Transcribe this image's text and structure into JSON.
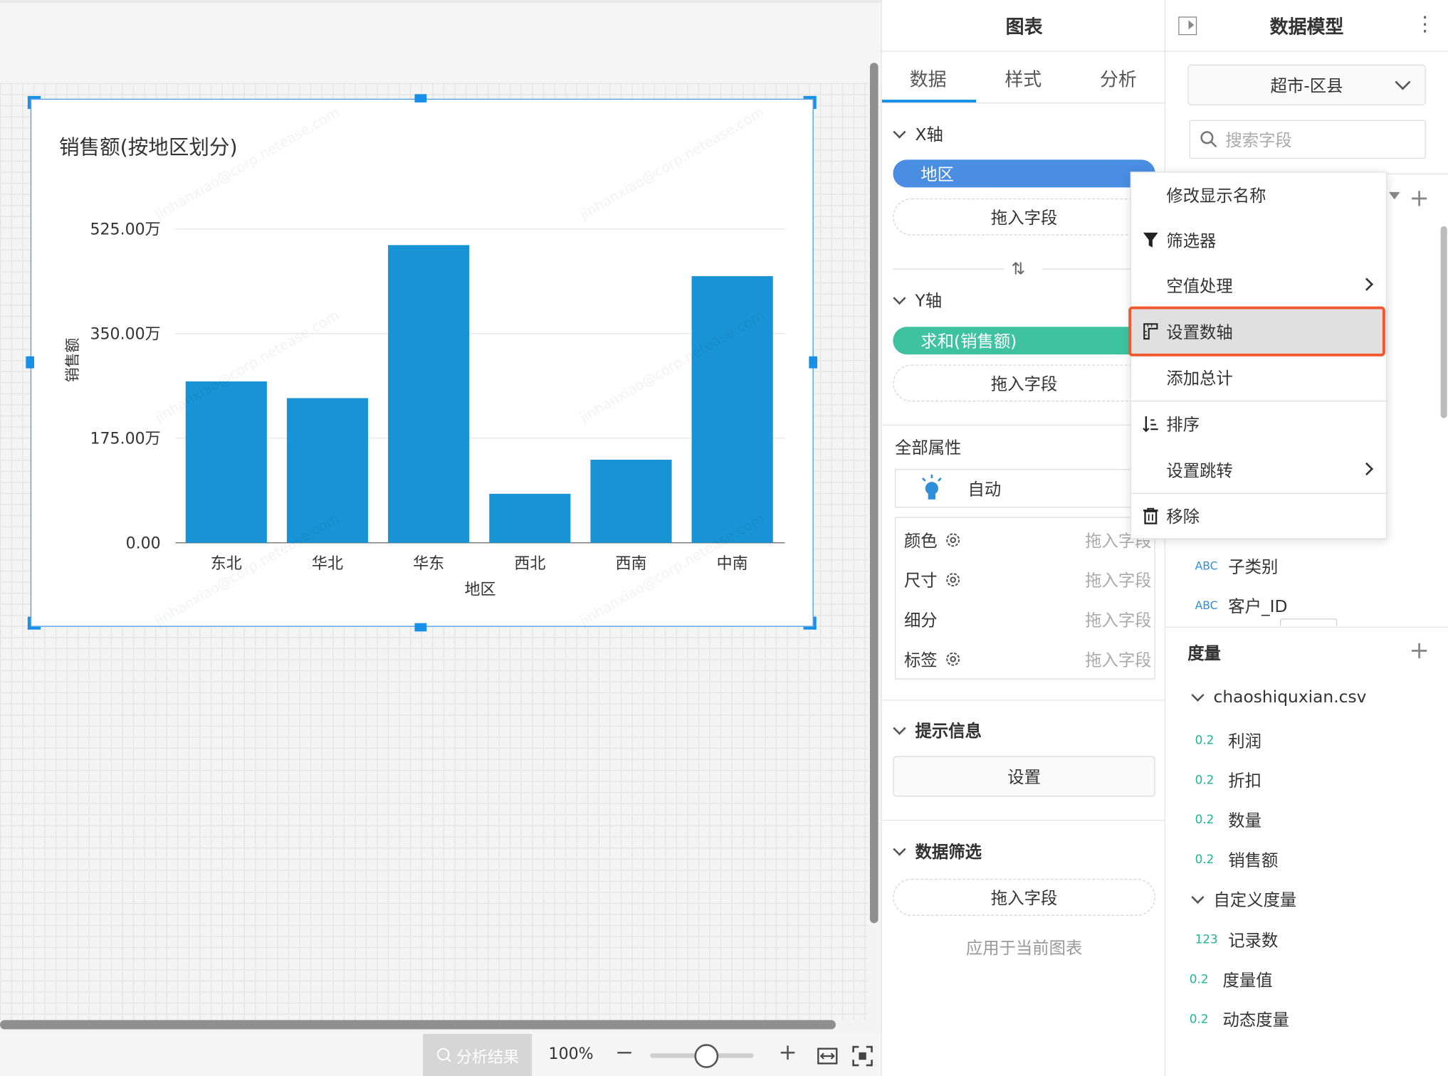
{
  "chart_panel": {
    "title": "图表",
    "tabs": [
      "数据",
      "样式",
      "分析"
    ],
    "x_axis": {
      "label": "X轴",
      "field": "地区",
      "drop": "拖入字段"
    },
    "y_axis": {
      "label": "Y轴",
      "field": "求和(销售额)",
      "drop": "拖入字段"
    },
    "all_props": {
      "label": "全部属性",
      "mode": "自动"
    },
    "attrs": [
      {
        "label": "颜色",
        "drop": "拖入字段"
      },
      {
        "label": "尺寸",
        "drop": "拖入字段"
      },
      {
        "label": "细分",
        "drop": "拖入字段"
      },
      {
        "label": "标签",
        "drop": "拖入字段"
      }
    ],
    "tooltip": {
      "label": "提示信息",
      "button": "设置"
    },
    "filter": {
      "label": "数据筛选",
      "drop": "拖入字段",
      "note": "应用于当前图表"
    }
  },
  "data_model": {
    "title": "数据模型",
    "dataset": "超市-区县",
    "search_placeholder": "搜索字段",
    "dimensions": [
      {
        "type": "ABC",
        "name": "子类别"
      },
      {
        "type": "ABC",
        "name": "客户_ID"
      }
    ],
    "measures_label": "度量",
    "measure_folders": [
      {
        "name": "chaoshiquxian.csv",
        "fields": [
          {
            "type": "0.2",
            "name": "利润"
          },
          {
            "type": "0.2",
            "name": "折扣"
          },
          {
            "type": "0.2",
            "name": "数量"
          },
          {
            "type": "0.2",
            "name": "销售额"
          }
        ]
      },
      {
        "name": "自定义度量",
        "fields": [
          {
            "type": "123",
            "name": "记录数"
          },
          {
            "type": "0.2",
            "name": "度量值"
          },
          {
            "type": "0.2",
            "name": "动态度量"
          }
        ]
      }
    ]
  },
  "context_menu": {
    "items": [
      "修改显示名称",
      "筛选器",
      "空值处理",
      "设置数轴",
      "添加总计",
      "排序",
      "设置跳转",
      "移除"
    ],
    "highlighted": "设置数轴"
  },
  "bottom_bar": {
    "analysis": "分析结果",
    "zoom": "100%"
  },
  "chart_data": {
    "type": "bar",
    "title": "销售额(按地区划分)",
    "xlabel": "地区",
    "ylabel": "销售额",
    "categories": [
      "东北",
      "华北",
      "华东",
      "西北",
      "西南",
      "中南"
    ],
    "values": [
      2700000,
      2420000,
      4980000,
      820000,
      1390000,
      4460000
    ],
    "yticks": [
      "0.00",
      "175.00万",
      "350.00万",
      "525.00万"
    ],
    "ytick_values": [
      0,
      1750000,
      3500000,
      5250000
    ],
    "ylim": [
      0,
      5250000
    ],
    "color": "#1893d6",
    "grid": true
  }
}
